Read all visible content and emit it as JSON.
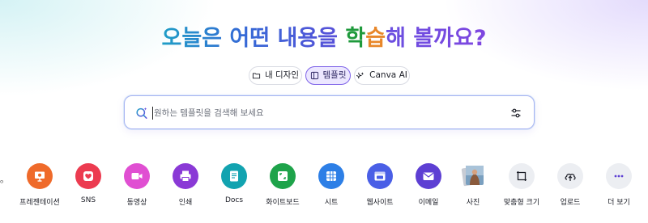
{
  "headline": {
    "part1": "오늘은 어떤 내용을 ",
    "highlight_a": "학",
    "highlight_b": "습",
    "part3": "해 볼까요?"
  },
  "pills": [
    {
      "label": "내 디자인",
      "icon": "folder-icon",
      "active": false
    },
    {
      "label": "템플릿",
      "icon": "template-icon",
      "active": true
    },
    {
      "label": "Canva AI",
      "icon": "sparkle-icon",
      "active": false
    }
  ],
  "search": {
    "placeholder": "원하는 템플릿을 검색해 보세요",
    "value": ""
  },
  "edge_glyph": "ᵒ",
  "categories": [
    {
      "label": "프레젠테이션",
      "icon": "presentation-icon",
      "color": "#ef6a2a"
    },
    {
      "label": "SNS",
      "icon": "heart-icon",
      "color": "#ec3b50"
    },
    {
      "label": "동영상",
      "icon": "video-icon",
      "color": "#e04fd2"
    },
    {
      "label": "인쇄",
      "icon": "printer-icon",
      "color": "#8a39d6"
    },
    {
      "label": "Docs",
      "icon": "document-icon",
      "color": "#12a3b0"
    },
    {
      "label": "화이트보드",
      "icon": "whiteboard-icon",
      "color": "#1ea34a"
    },
    {
      "label": "시트",
      "icon": "sheet-icon",
      "color": "#2d7fe6"
    },
    {
      "label": "웹사이트",
      "icon": "website-icon",
      "color": "#4a5fe6"
    },
    {
      "label": "이메일",
      "icon": "mail-icon",
      "color": "#5d3fd3"
    },
    {
      "label": "사진",
      "icon": "photo-icon",
      "color": "#9fb3c8"
    },
    {
      "label": "맞춤형 크기",
      "icon": "custom-size-icon",
      "color": "#eceef2"
    },
    {
      "label": "업로드",
      "icon": "upload-icon",
      "color": "#eceef2"
    },
    {
      "label": "더 보기",
      "icon": "more-icon",
      "color": "#eceef2"
    }
  ]
}
